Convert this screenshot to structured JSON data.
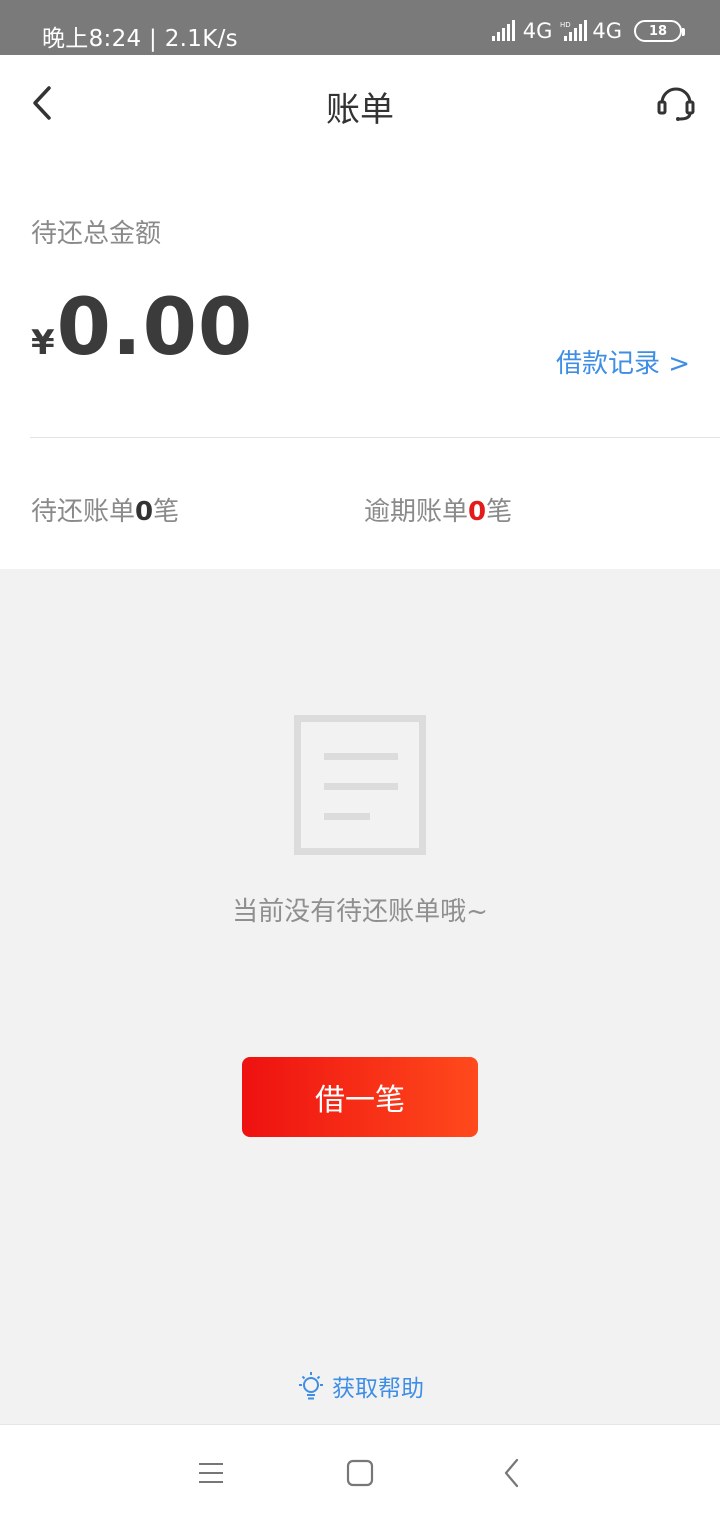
{
  "status_bar": {
    "time_speed": "晚上8:24 | 2.1K/s",
    "network_1": "4G",
    "network_2": "4G",
    "battery": "18"
  },
  "nav": {
    "title": "账单"
  },
  "summary": {
    "total_label": "待还总金额",
    "currency": "¥",
    "amount": "0.00",
    "loan_record_link": "借款记录 >",
    "pending_prefix": "待还账单",
    "pending_count": "0",
    "pending_suffix": "笔",
    "overdue_prefix": "逾期账单",
    "overdue_count": "0",
    "overdue_suffix": "笔"
  },
  "empty": {
    "message": "当前没有待还账单哦~",
    "borrow_button": "借一笔",
    "help_link": "获取帮助"
  },
  "colors": {
    "accent_blue": "#3f8ee6",
    "overdue_red": "#e31b1b",
    "button_gradient_start": "#ee1111",
    "button_gradient_end": "#ff4a1c"
  },
  "icons": {
    "back": "chevron-left-icon",
    "service": "headset-icon",
    "empty": "document-icon",
    "help": "lightbulb-icon",
    "sys_menu": "menu-icon",
    "sys_home": "home-square-icon",
    "sys_back": "back-triangle-icon"
  }
}
